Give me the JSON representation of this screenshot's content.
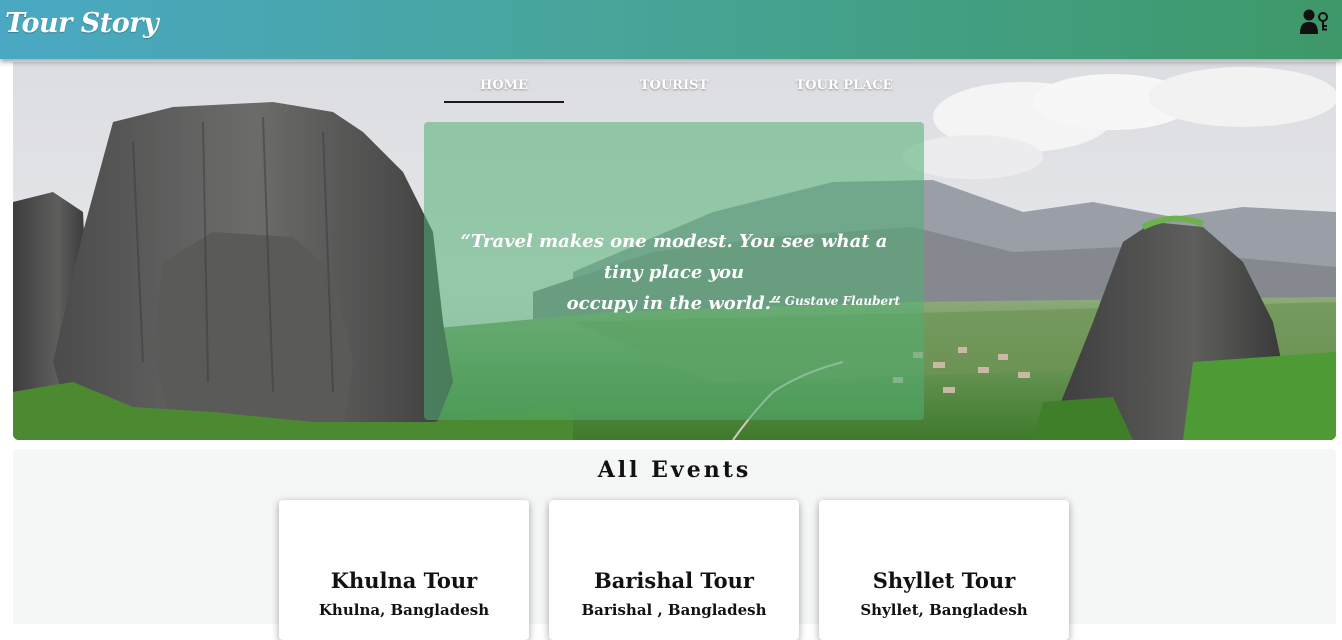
{
  "header": {
    "brand": "Tour Story",
    "user_icon": "user-key-icon"
  },
  "nav": {
    "tabs": [
      {
        "label": "HOME",
        "active": true
      },
      {
        "label": "TOURIST",
        "active": false
      },
      {
        "label": "TOUR PLACE",
        "active": false
      }
    ]
  },
  "hero": {
    "quote_line1": "“Travel makes one modest. You see what a tiny place you",
    "quote_line2": "occupy in the world.”",
    "author": "— Gustave Flaubert"
  },
  "events": {
    "title": "All Events",
    "cards": [
      {
        "name": "Khulna Tour",
        "location": "Khulna, Bangladesh"
      },
      {
        "name": "Barishal Tour",
        "location": "Barishal , Bangladesh"
      },
      {
        "name": "Shyllet Tour",
        "location": "Shyllet, Bangladesh"
      }
    ]
  },
  "colors": {
    "header_start": "#4aa8c4",
    "header_end": "#3e9868",
    "quote_overlay": "#50af73",
    "text_dark": "#111111"
  }
}
